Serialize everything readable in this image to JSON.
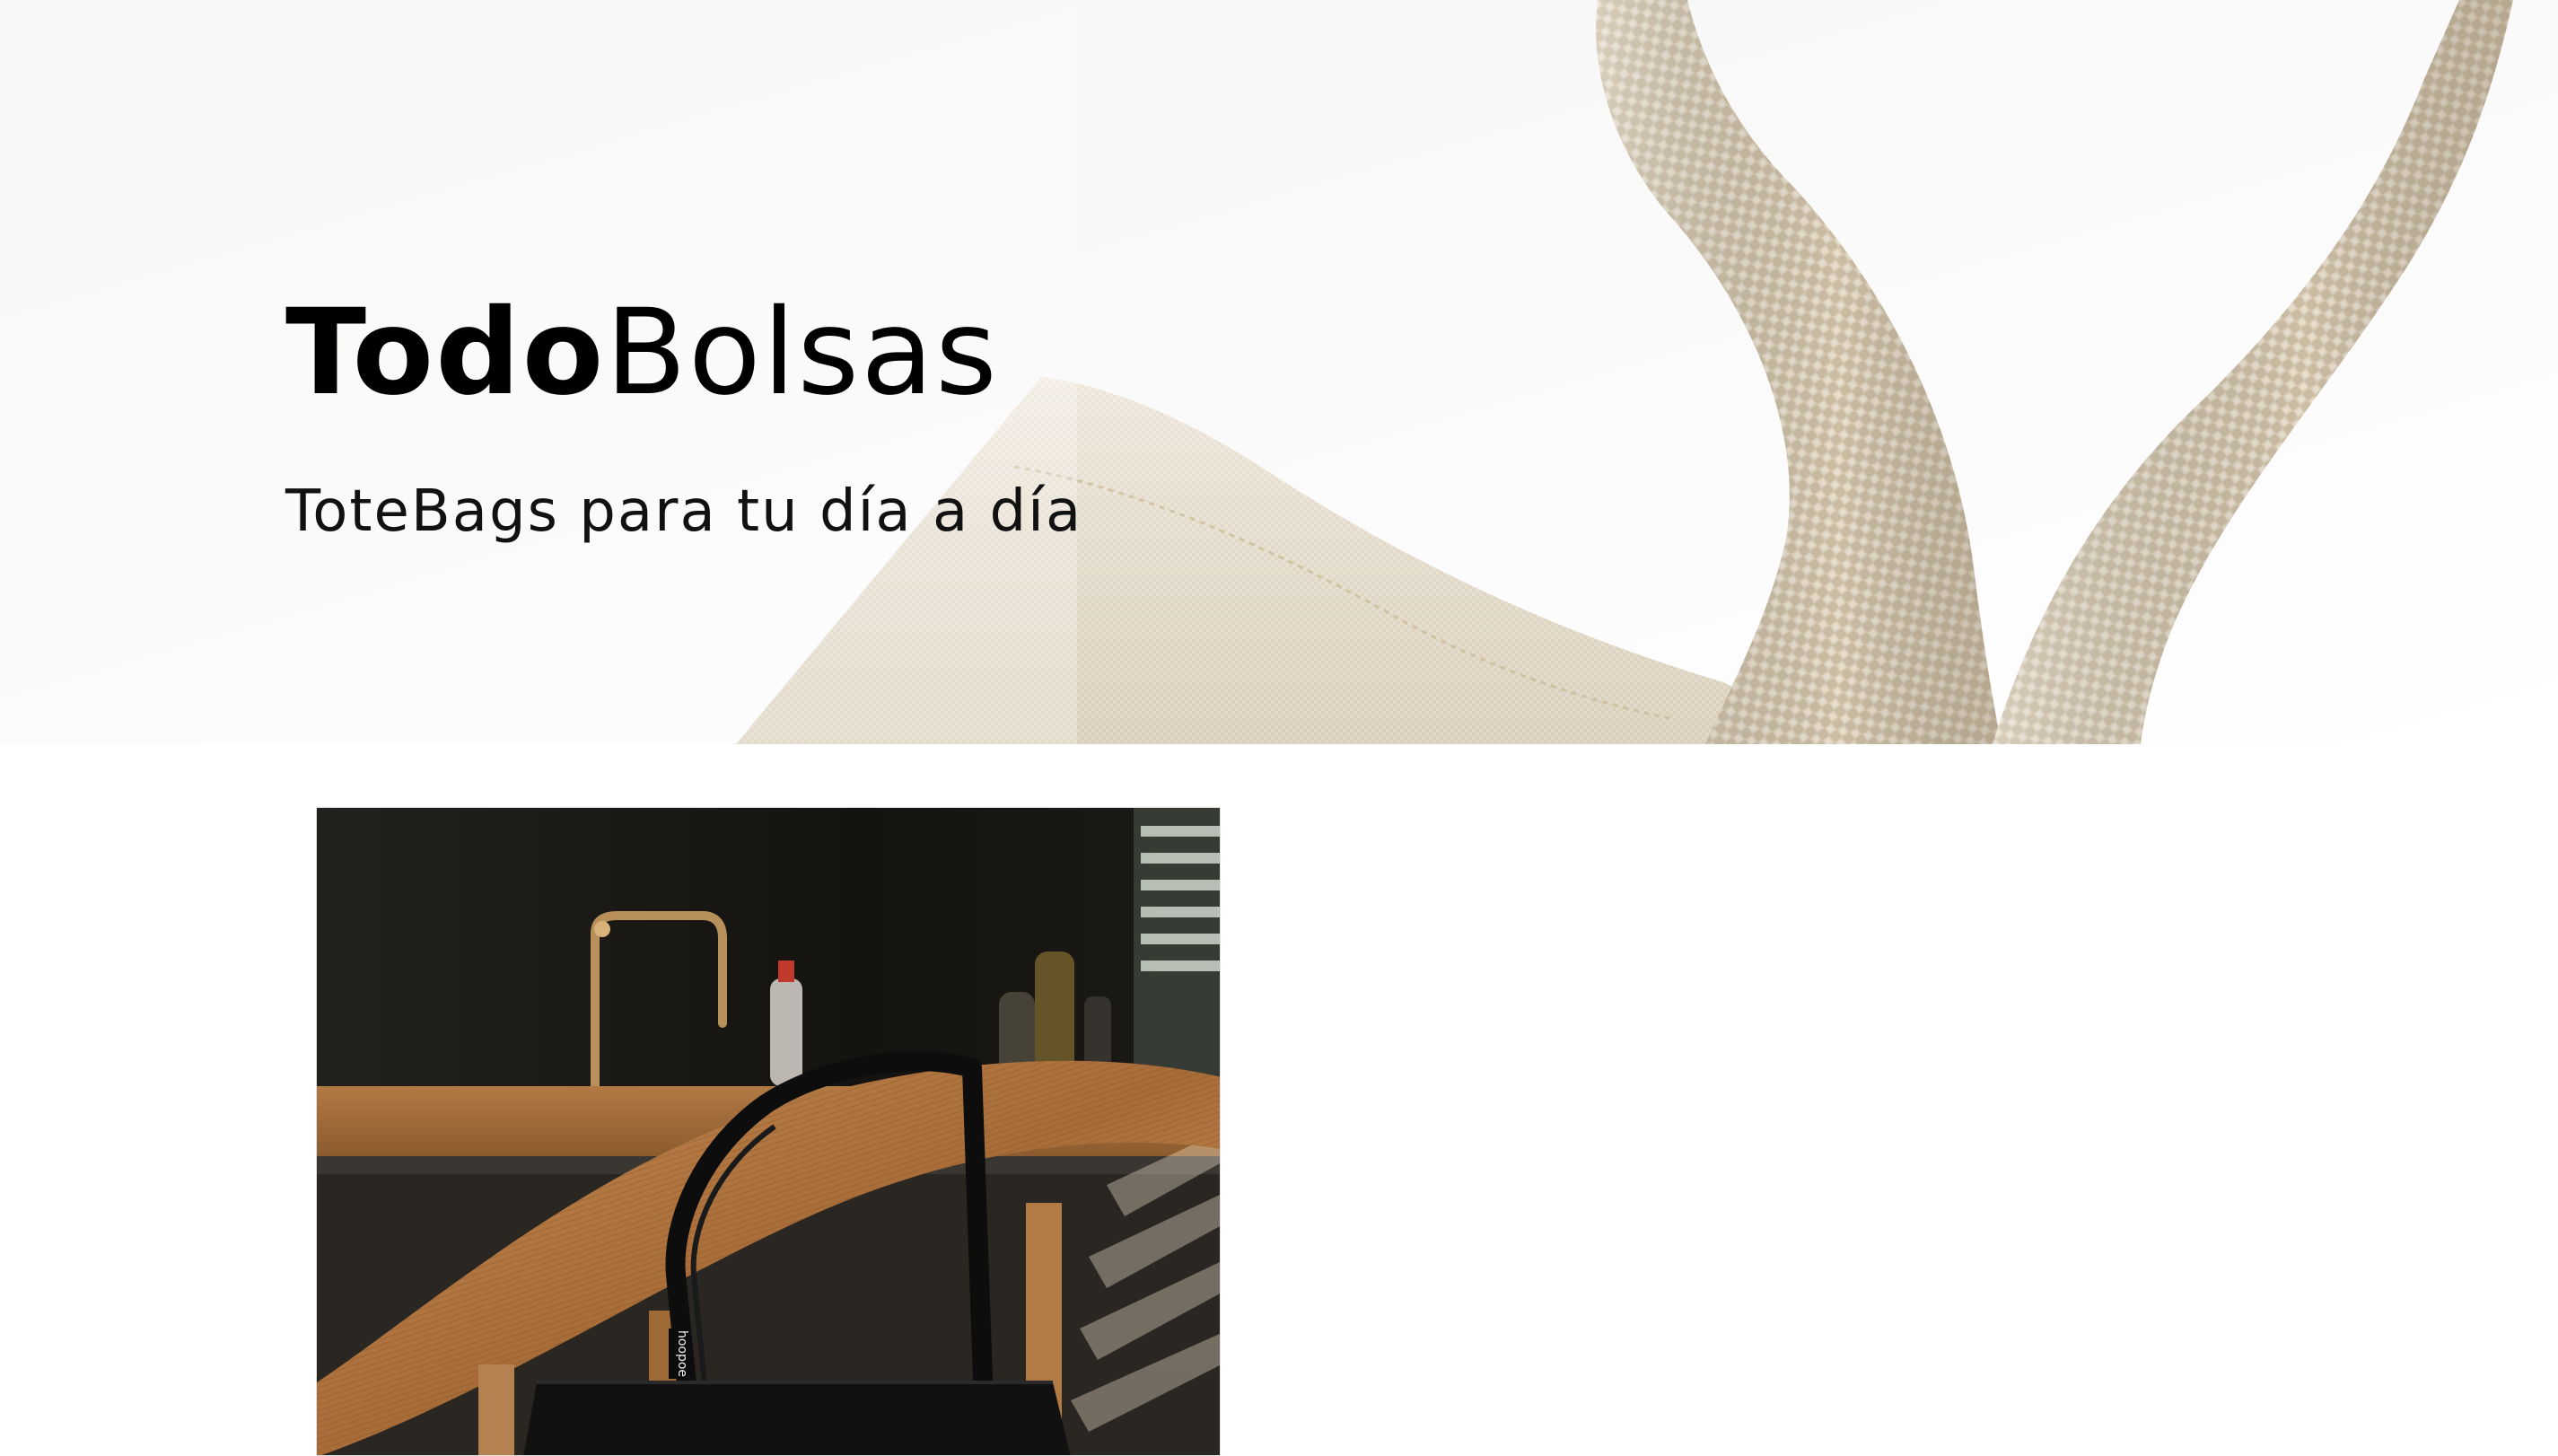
{
  "hero": {
    "title_bold": "Todo",
    "title_light": "Bolsas",
    "subtitle": "ToteBags para tu día a día",
    "background_image": "canvas-tote-bag-handle"
  },
  "products": [
    {
      "image": "black-tote-bag-on-wooden-chair",
      "bag_tag_text": "hoopoe"
    }
  ],
  "colors": {
    "hero_background": "#f6f6f5",
    "canvas": "#e6dccb",
    "strap": "#d6c8b2",
    "title_text": "#000000"
  }
}
